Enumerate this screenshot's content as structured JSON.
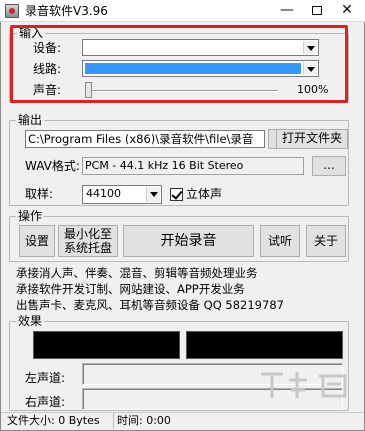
{
  "window": {
    "title": "录音软件V3.96",
    "minimize_glyph": "—",
    "close_glyph": "✕"
  },
  "input_group": {
    "label": "输入",
    "device_label": "设备:",
    "device_value": "",
    "line_label": "线路:",
    "line_value": "",
    "volume_label": "声音:",
    "volume_value": "100%",
    "volume_level": 0.0
  },
  "output_group": {
    "label": "输出",
    "path_value": "C:\\Program Files (x86)\\录音软件\\file\\录音",
    "browse_button": "...",
    "open_folder_button": "打开文件夹",
    "wav_label": "WAV格式:",
    "wav_value": "PCM - 44.1 kHz 16 Bit Stereo",
    "wav_browse_button": "...",
    "sample_label": "取样:",
    "sample_value": "44100",
    "stereo_label": "立体声",
    "stereo_checked": true
  },
  "operation_group": {
    "label": "操作",
    "settings_button": "设置",
    "minimize_tray_button_line1": "最小化至",
    "minimize_tray_button_line2": "系统托盘",
    "start_button": "开始录音",
    "listen_button": "试听",
    "about_button": "关于"
  },
  "info_lines": [
    "承接消人声、伴奏、混音、剪辑等音频处理业务",
    "承接软件开发订制、网站建设、APP开发业务",
    "出售声卡、麦克风、耳机等音频设备 QQ 58219787"
  ],
  "effects_group": {
    "label": "效果",
    "left_channel_label": "左声道:",
    "right_channel_label": "右声道:"
  },
  "status_bar": {
    "file_size": "文件大小: 0 Bytes",
    "time": "时间: 0:00"
  },
  "colors": {
    "highlight_red": "#e02020",
    "selection_blue": "#3399ff"
  },
  "watermark": {
    "text": "下载吧"
  }
}
